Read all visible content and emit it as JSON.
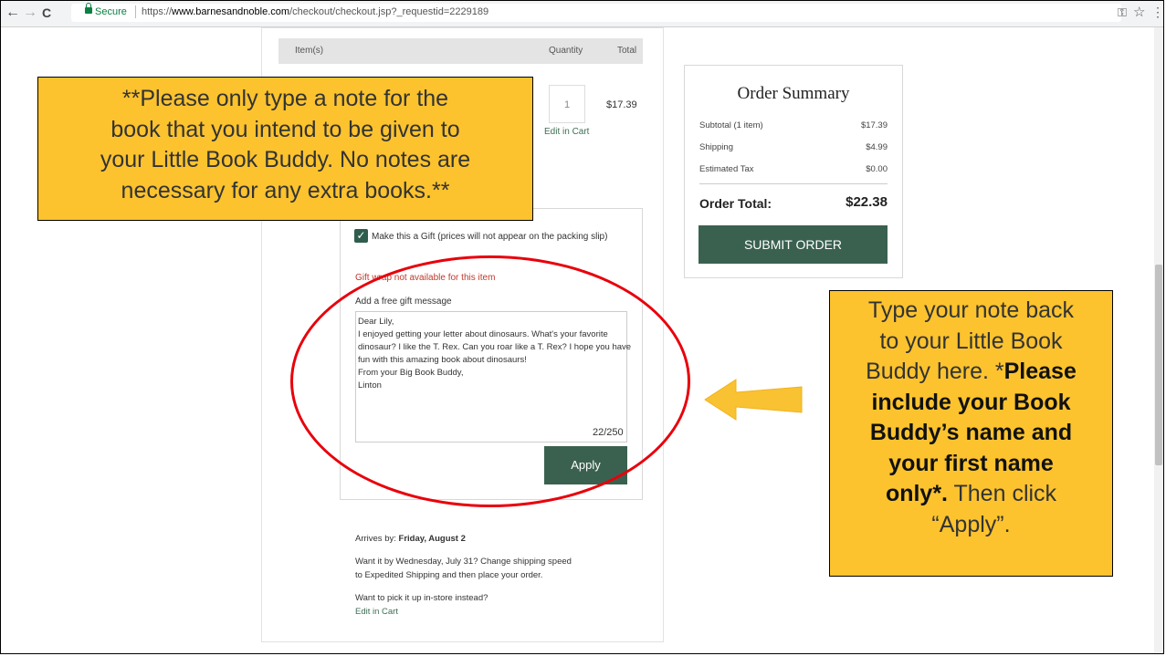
{
  "browser": {
    "back": "←",
    "forward": "→",
    "reload": "C",
    "secure_label": "Secure",
    "url_prefix": "https://",
    "url_domain": "www.barnesandnoble.com",
    "url_path": "/checkout/checkout.jsp?_requestid=2229189",
    "icons": {
      "key": "key-icon",
      "star": "star-icon",
      "menu": "menu-icon"
    }
  },
  "items": {
    "col_items": "Item(s)",
    "col_quantity": "Quantity",
    "col_total": "Total",
    "quantity": "1",
    "price": "$17.39",
    "edit_in_cart": "Edit in Cart"
  },
  "gift": {
    "checkbox_label": "Make this a Gift (prices will not appear on the packing slip)",
    "checked": true,
    "giftwrap_notice": "Gift wrap not available for this item",
    "message_label": "Add a free gift message",
    "message_lines": [
      "Dear Lily,",
      "I enjoyed getting your letter about dinosaurs. What's your favorite",
      "dinosaur? I like the T. Rex. Can you roar like a T. Rex? I hope you have",
      "fun with this amazing book about dinosaurs!",
      "From your Big Book Buddy,",
      "Linton"
    ],
    "char_count": "22/250",
    "apply_label": "Apply"
  },
  "delivery": {
    "arrives_prefix": "Arrives by:",
    "arrives_date": "Friday, August 2",
    "expedite_line1": "Want it by Wednesday, July 31? Change shipping speed",
    "expedite_line2": "to Expedited Shipping and then place your order.",
    "pickup_question": "Want to pick it up in-store instead?",
    "edit_in_cart": "Edit in Cart"
  },
  "summary": {
    "title": "Order Summary",
    "subtotal_label": "Subtotal (1 item)",
    "subtotal_value": "$17.39",
    "shipping_label": "Shipping",
    "shipping_value": "$4.99",
    "tax_label": "Estimated Tax",
    "tax_value": "$0.00",
    "total_label": "Order Total:",
    "total_value": "$22.38",
    "submit_label": "SUBMIT ORDER"
  },
  "callouts": {
    "top_lines": [
      "**Please only type a note for the",
      "book that you intend to be given to",
      "your Little Book Buddy. No notes are",
      "necessary for any extra books.**"
    ],
    "right_line1": "Type your note back",
    "right_line2": "to your Little Book",
    "right_line3_normal": "Buddy here. *",
    "right_line3_bold": "Please",
    "right_line4": "include your Book",
    "right_line5": "Buddy’s name and",
    "right_line6": "your first name",
    "right_line7_bold": "only*.",
    "right_line7_normal": " Then click",
    "right_line8": "“Apply”.",
    "colors": {
      "callout_fill": "#fcc32e",
      "ellipse": "#e8000b",
      "arrow": "#f9c232"
    }
  },
  "colors": {
    "brand_green": "#3a6150",
    "secure_green": "#0b8043",
    "error_red": "#c0392b"
  }
}
